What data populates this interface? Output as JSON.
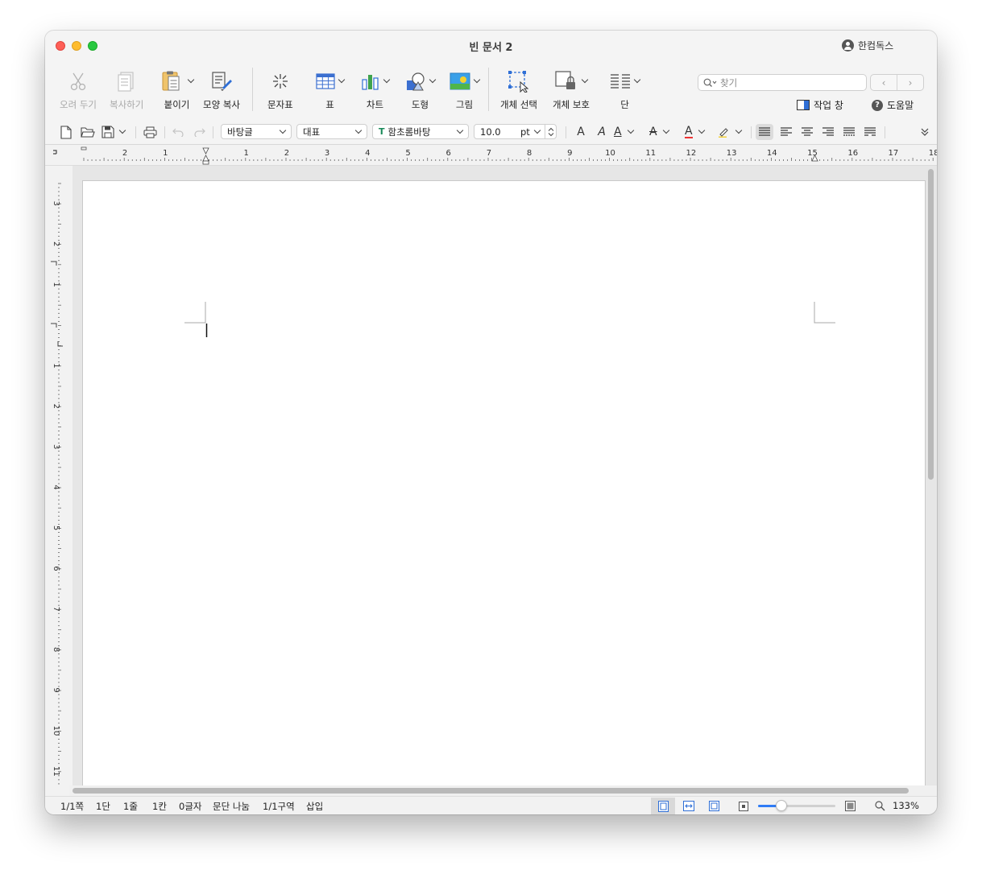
{
  "window": {
    "title": "빈 문서 2",
    "account": "한컴독스"
  },
  "toolbar": {
    "cut": "오려 두기",
    "copy": "복사하기",
    "paste": "붙이기",
    "format_copy": "모양 복사",
    "symbols": "문자표",
    "table": "표",
    "chart": "차트",
    "shape": "도형",
    "picture": "그림",
    "select_object": "개체 선택",
    "protect_object": "개체 보호",
    "columns": "단"
  },
  "search": {
    "placeholder": "찾기"
  },
  "side_links": {
    "task_pane": "작업 창",
    "help": "도움말"
  },
  "format": {
    "style": "바탕글",
    "font_group": "대표",
    "font": "함초롬바탕",
    "size": "10.0",
    "unit": "pt"
  },
  "ruler": {
    "h_ticks": [
      "2",
      "1",
      "1",
      "2",
      "3",
      "4",
      "5",
      "6",
      "7",
      "8",
      "9",
      "10",
      "11",
      "12",
      "13",
      "14",
      "15",
      "16",
      "17",
      "18"
    ],
    "v_ticks": [
      "3",
      "2",
      "1",
      "1",
      "2",
      "3",
      "4",
      "5",
      "6",
      "7",
      "8",
      "9",
      "10",
      "11"
    ]
  },
  "status": {
    "page": "1/1쪽",
    "column": "1단",
    "line": "1줄",
    "col_pos": "1칸",
    "chars": "0글자",
    "para_break": "문단 나눔",
    "section": "1/1구역",
    "mode": "삽입",
    "zoom": "133%",
    "zoom_level": 0.3
  },
  "colors": {
    "accent": "#2f7cf6",
    "close": "#fe5f57",
    "minimize": "#febc2e",
    "maximize": "#28c840"
  }
}
